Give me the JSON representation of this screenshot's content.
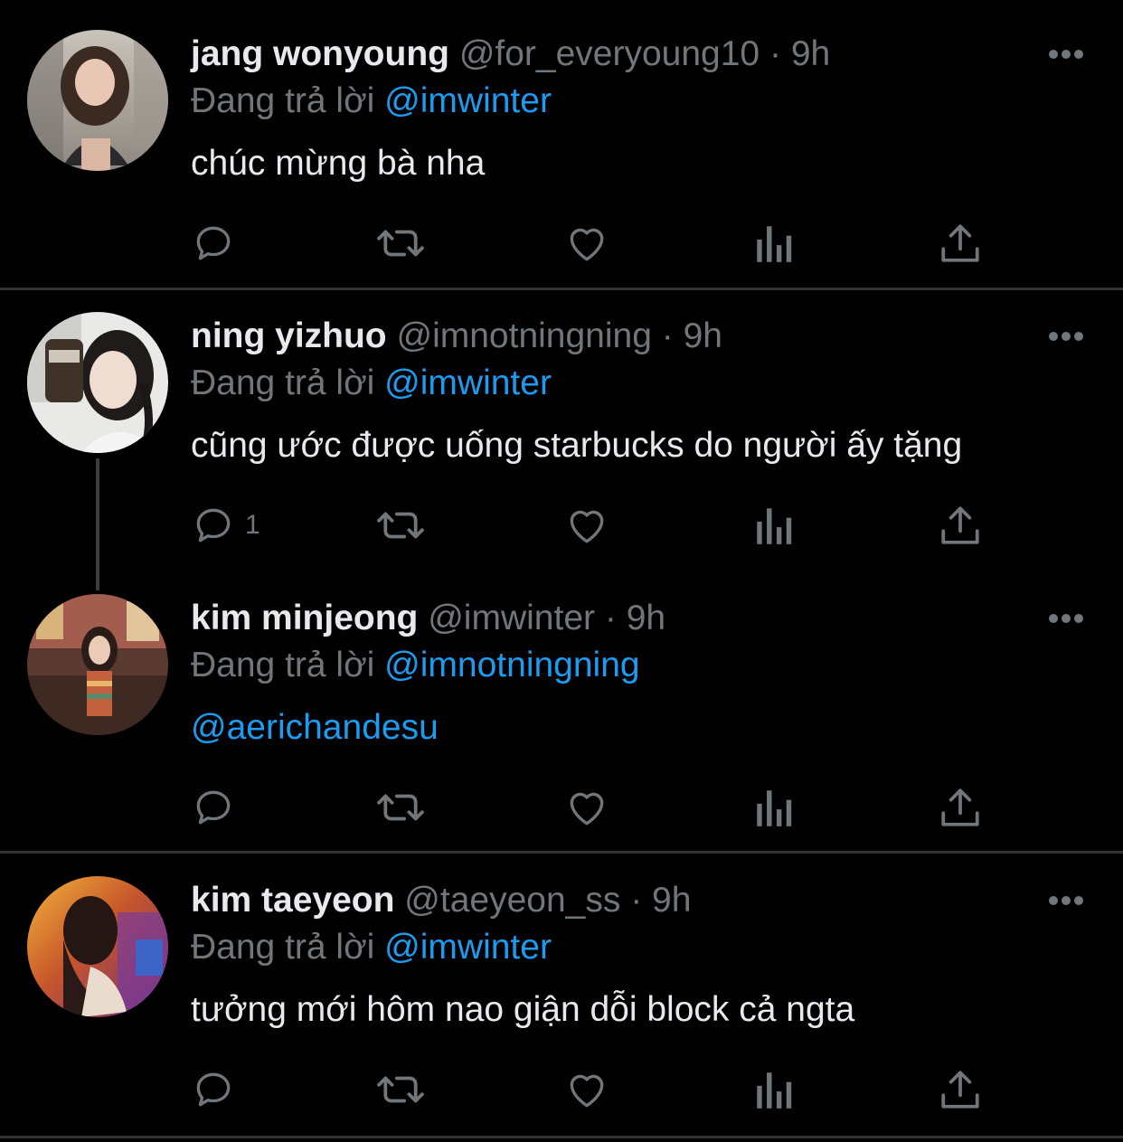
{
  "colors": {
    "background": "#000000",
    "text": "#e7e9ea",
    "muted": "#71767b",
    "accent": "#1d9bf0",
    "divider": "#2f3336"
  },
  "tweets": [
    {
      "display_name": "jang wonyoung",
      "handle": "@for_everyoung10",
      "separator": "·",
      "time": "9h",
      "reply_prefix": "Đang trả lời",
      "reply_to": "@imwinter",
      "text": "chúc mừng bà nha",
      "reply_count": "",
      "more_icon": "more-icon"
    },
    {
      "display_name": "ning yizhuo",
      "handle": "@imnotningning",
      "separator": "·",
      "time": "9h",
      "reply_prefix": "Đang trả lời",
      "reply_to": "@imwinter",
      "text": "cũng ước được uống starbucks do người ấy tặng",
      "reply_count": "1",
      "more_icon": "more-icon"
    },
    {
      "display_name": "kim minjeong",
      "handle": "@imwinter",
      "separator": "·",
      "time": "9h",
      "reply_prefix": "Đang trả lời",
      "reply_to": "@imnotningning",
      "text": "@aerichandesu",
      "reply_count": "",
      "more_icon": "more-icon"
    },
    {
      "display_name": "kim taeyeon",
      "handle": "@taeyeon_ss",
      "separator": "·",
      "time": "9h",
      "reply_prefix": "Đang trả lời",
      "reply_to": "@imwinter",
      "text": "tưởng mới hôm nao giận dỗi block cả ngta",
      "reply_count": "",
      "more_icon": "more-icon"
    }
  ],
  "action_icons": [
    "reply-icon",
    "retweet-icon",
    "like-icon",
    "analytics-icon",
    "share-icon"
  ]
}
